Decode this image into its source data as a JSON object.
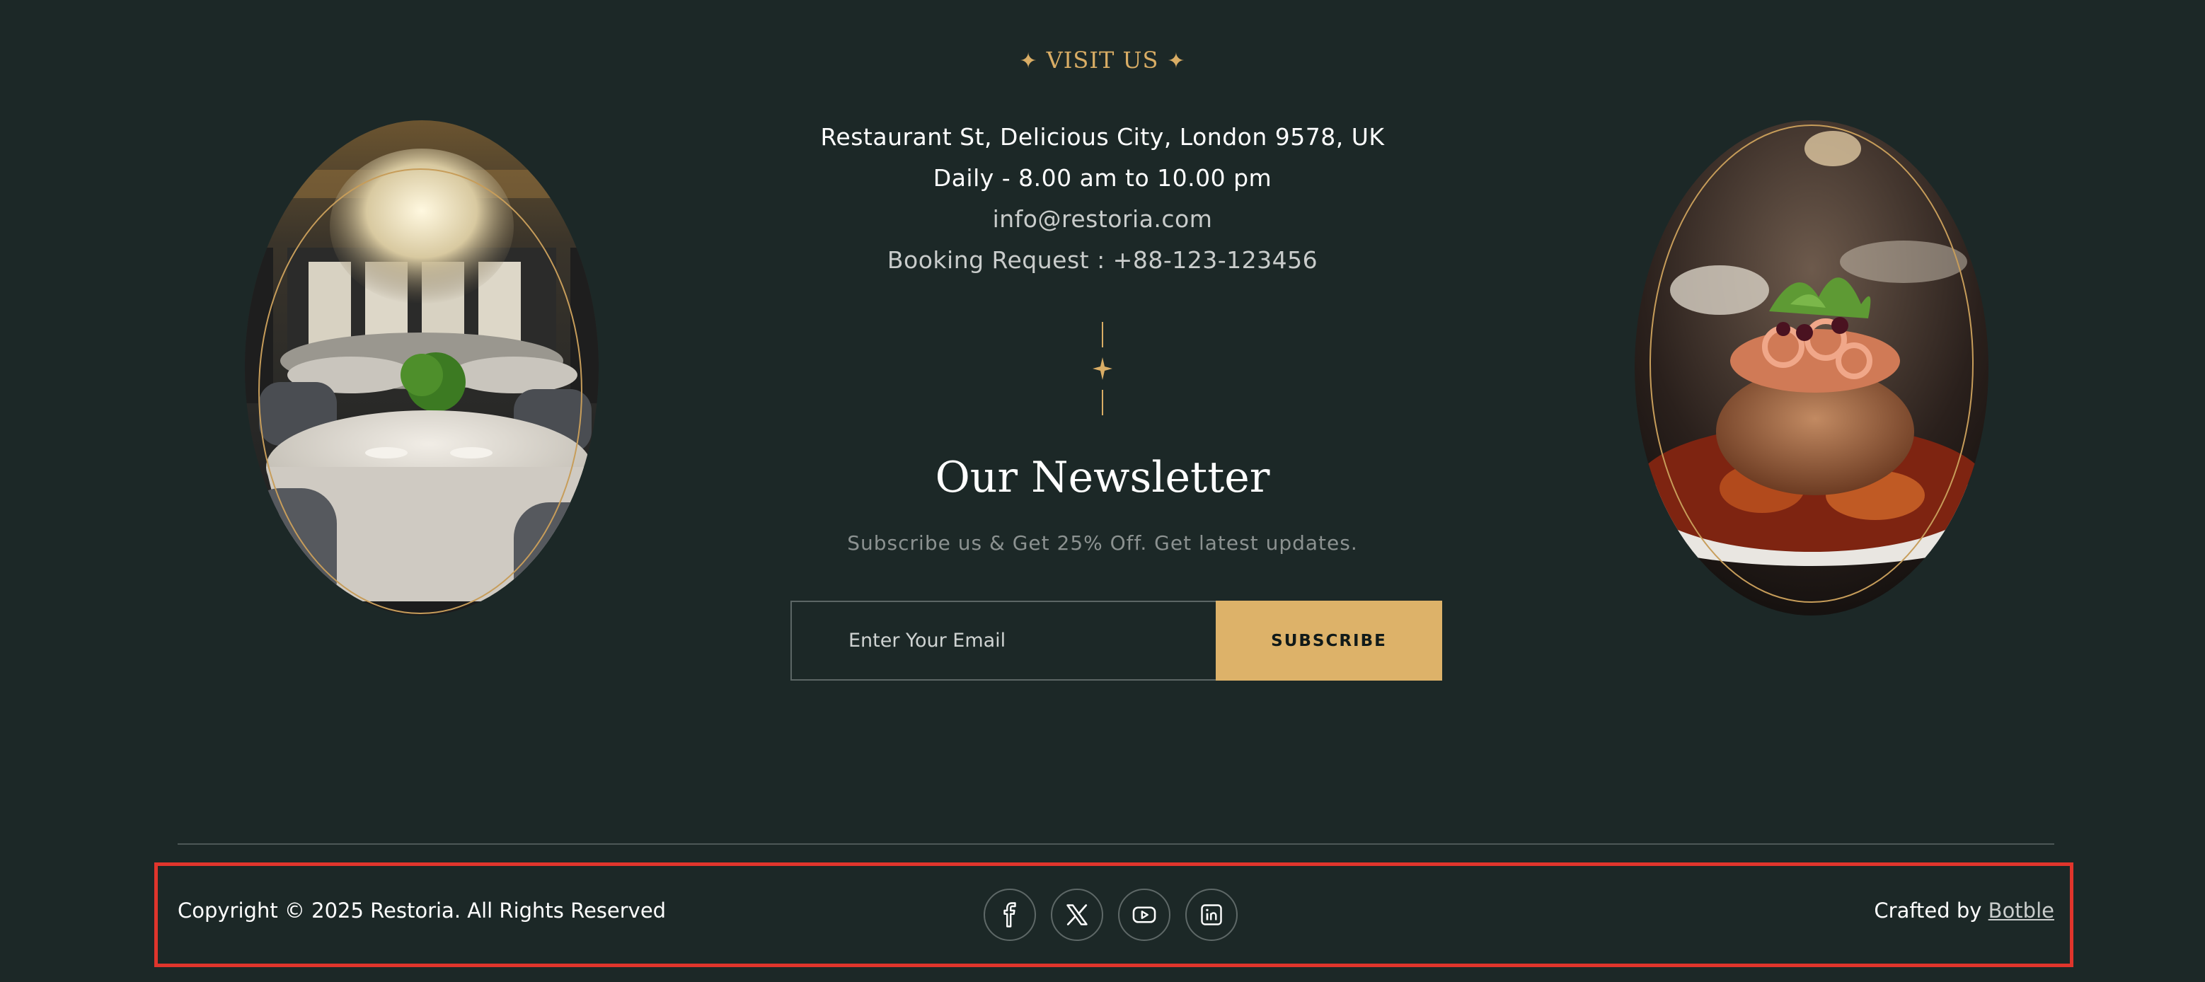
{
  "visit": {
    "label": "VISIT US",
    "star_glyph": "✦",
    "address": "Restaurant St, Delicious City, London 9578, UK",
    "hours": "Daily - 8.00 am to 10.00 pm",
    "email": "info@restoria.com",
    "booking": "Booking Request : +88-123-123456"
  },
  "newsletter": {
    "title": "Our Newsletter",
    "subtitle": "Subscribe us & Get 25% Off. Get latest updates.",
    "input_placeholder": "Enter Your Email",
    "button_label": "SUBSCRIBE"
  },
  "images": {
    "left": "restaurant-dining-room-photo",
    "right": "plated-dish-photo"
  },
  "footer": {
    "copyright": "Copyright © 2025 Restoria. All Rights Reserved",
    "crafted_prefix": "Crafted by ",
    "crafted_link": "Botble",
    "social": [
      {
        "icon": "facebook-icon"
      },
      {
        "icon": "x-twitter-icon"
      },
      {
        "icon": "youtube-icon"
      },
      {
        "icon": "linkedin-icon"
      }
    ]
  },
  "colors": {
    "background": "#1c2827",
    "accent_gold": "#ddb269",
    "highlight_red": "#e0352c"
  }
}
